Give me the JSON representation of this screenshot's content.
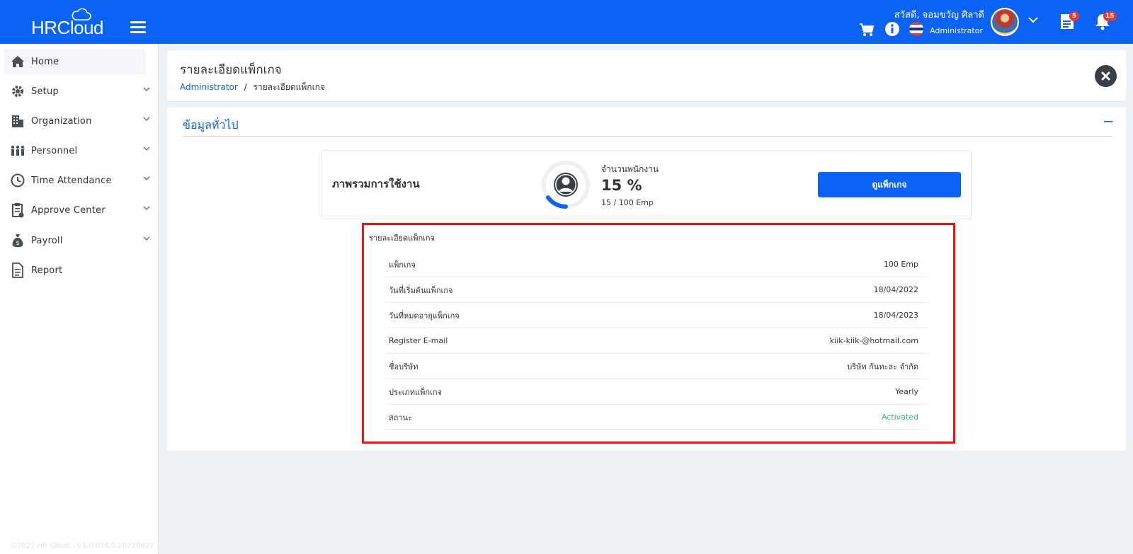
{
  "app": {
    "logo_text": "HRCloud"
  },
  "topbar": {
    "greeting": "สวัสดี, จอมขวัญ ศิลาดี",
    "role": "Administrator",
    "doc_badge": "5",
    "bell_badge": "15"
  },
  "sidebar": {
    "items": [
      {
        "label": "Home"
      },
      {
        "label": "Setup"
      },
      {
        "label": "Organization"
      },
      {
        "label": "Personnel"
      },
      {
        "label": "Time Attendance"
      },
      {
        "label": "Approve Center"
      },
      {
        "label": "Payroll"
      },
      {
        "label": "Report"
      }
    ],
    "footer": "©2022 HR Cloud - V1.0.016.0.20220622"
  },
  "header": {
    "title": "รายละเอียดแพ็กเกจ",
    "breadcrumb_root": "Administrator",
    "breadcrumb_sep": "/",
    "breadcrumb_current": "รายละเอียดแพ็กเกจ"
  },
  "general": {
    "section_title": "ข้อมูลทั่วไป",
    "collapse_symbol": "−",
    "usage_title": "ภาพรวมการใช้งาน",
    "employee_label": "จำนวนพนักงาน",
    "employee_percent": "15 %",
    "employee_percent_value": 15,
    "employee_count": "15 / 100 Emp",
    "view_button": "ดูแพ็กเกจ"
  },
  "package": {
    "title": "รายละเอียดแพ็กเกจ",
    "rows": [
      {
        "label": "แพ็กเกจ",
        "value": "100 Emp"
      },
      {
        "label": "วันที่เริ่มต้นแพ็กเกจ",
        "value": "18/04/2022"
      },
      {
        "label": "วันที่หมดอายุแพ็กเกจ",
        "value": "18/04/2023"
      },
      {
        "label": "Register E-mail",
        "value": "kiik-kiik-@hotmail.com"
      },
      {
        "label": "ชื่อบริษัท",
        "value": "บริษัท กันทะละ จำกัด"
      },
      {
        "label": "ประเภทแพ็กเกจ",
        "value": "Yearly"
      },
      {
        "label": "สถานะ",
        "value": "Activated"
      }
    ]
  },
  "colors": {
    "brand": "#0b63f6",
    "status_active": "#2ebd6b",
    "highlight": "#f20f0f"
  }
}
